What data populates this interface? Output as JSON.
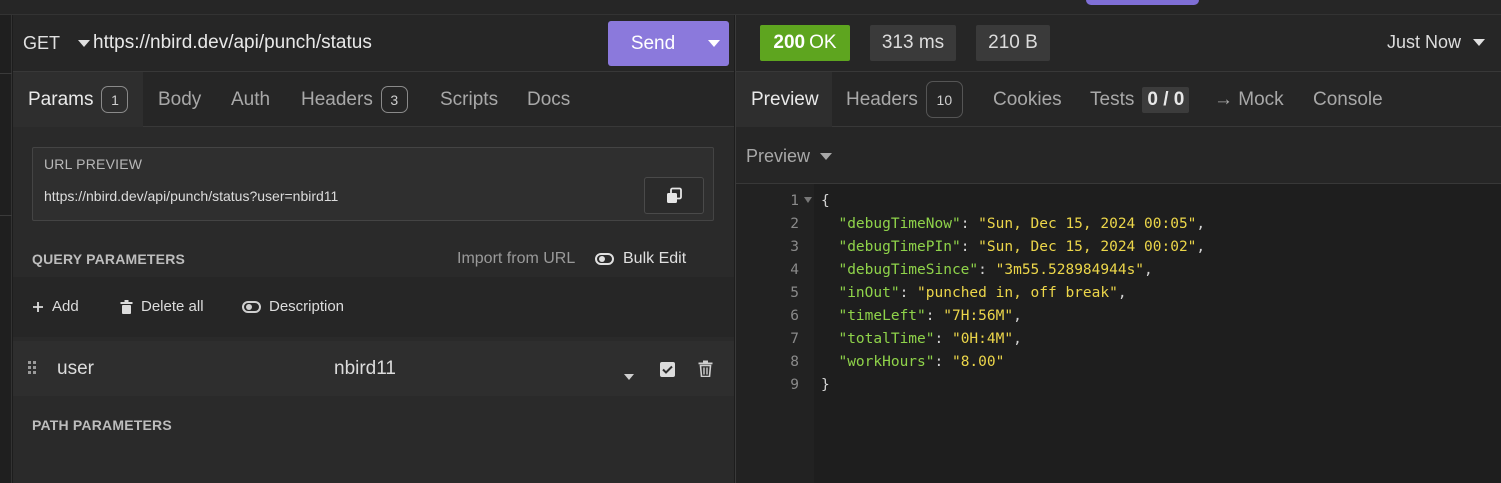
{
  "request": {
    "method": "GET",
    "url": "https://nbird.dev/api/punch/status",
    "send_label": "Send",
    "tabs": [
      {
        "label": "Params",
        "badge": "1"
      },
      {
        "label": "Body"
      },
      {
        "label": "Auth"
      },
      {
        "label": "Headers",
        "badge": "3"
      },
      {
        "label": "Scripts"
      },
      {
        "label": "Docs"
      }
    ],
    "url_preview": {
      "title": "URL PREVIEW",
      "value": "https://nbird.dev/api/punch/status?user=nbird11"
    },
    "query_parameters": {
      "title": "QUERY PARAMETERS",
      "import_label": "Import from URL",
      "bulk_edit_label": "Bulk Edit",
      "actions": {
        "add": "Add",
        "delete_all": "Delete all",
        "description": "Description"
      },
      "rows": [
        {
          "key": "user",
          "value": "nbird11",
          "enabled": true
        }
      ]
    },
    "path_parameters_title": "PATH PARAMETERS"
  },
  "response": {
    "status_code": "200",
    "status_text": "OK",
    "status_color": "#5ea51f",
    "time": "313 ms",
    "size": "210 B",
    "timestamp": "Just Now",
    "tabs": [
      {
        "label": "Preview"
      },
      {
        "label": "Headers",
        "badge": "10"
      },
      {
        "label": "Cookies"
      },
      {
        "label": "Tests",
        "value": "0 / 0"
      },
      {
        "label": "→ Mock"
      },
      {
        "label": "Console"
      }
    ],
    "preview_mode": "Preview",
    "body_lines": [
      {
        "n": "1",
        "text": "{"
      },
      {
        "n": "2",
        "key": "\"debugTimeNow\"",
        "value": "\"Sun, Dec 15, 2024 00:05\"",
        "end": ","
      },
      {
        "n": "3",
        "key": "\"debugTimePIn\"",
        "value": "\"Sun, Dec 15, 2024 00:02\"",
        "end": ","
      },
      {
        "n": "4",
        "key": "\"debugTimeSince\"",
        "value": "\"3m55.528984944s\"",
        "end": ","
      },
      {
        "n": "5",
        "key": "\"inOut\"",
        "value": "\"punched in, off break\"",
        "end": ","
      },
      {
        "n": "6",
        "key": "\"timeLeft\"",
        "value": "\"7H:56M\"",
        "end": ","
      },
      {
        "n": "7",
        "key": "\"totalTime\"",
        "value": "\"0H:4M\"",
        "end": ","
      },
      {
        "n": "8",
        "key": "\"workHours\"",
        "value": "\"8.00\"",
        "end": ""
      },
      {
        "n": "9",
        "text": "}"
      }
    ]
  },
  "colors": {
    "accent": "#8b79dc",
    "json_key": "#8fd34a",
    "json_string": "#ecd64a"
  }
}
